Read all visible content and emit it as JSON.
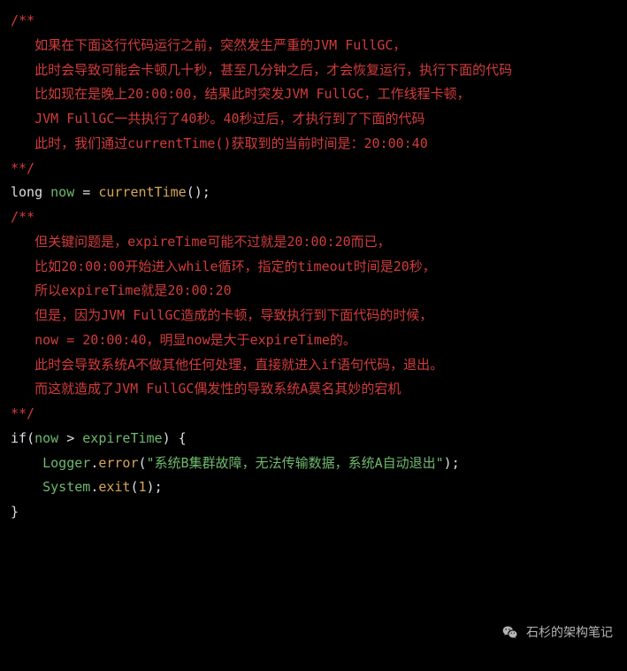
{
  "code": {
    "c1_open": "/**",
    "c1_l1": "   如果在下面这行代码运行之前，突然发生严重的JVM FullGC，",
    "c1_l2": "   此时会导致可能会卡顿几十秒，甚至几分钟之后，才会恢复运行，执行下面的代码",
    "c1_blank1": "",
    "c1_l3": "   比如现在是晚上20:00:00，结果此时突发JVM FullGC，工作线程卡顿，",
    "c1_l4": "   JVM FullGC一共执行了40秒。40秒过后，才执行到了下面的代码",
    "c1_blank2": "",
    "c1_l5": "   此时，我们通过currentTime()获取到的当前时间是：20:00:40",
    "c1_close": "**/",
    "stmt1_kw": "long",
    "stmt1_var": "now",
    "stmt1_eq": " = ",
    "stmt1_fn": "currentTime",
    "stmt1_paren": "()",
    "stmt1_semi": ";",
    "blank_mid": "",
    "c2_open": "/**",
    "c2_l1": "   但关键问题是，expireTime可能不过就是20:00:20而已，",
    "c2_l2": "   比如20:00:00开始进入while循环，指定的timeout时间是20秒，",
    "c2_l3": "   所以expireTime就是20:00:20",
    "c2_blank1": "",
    "c2_l4": "   但是，因为JVM FullGC造成的卡顿，导致执行到下面代码的时候，",
    "c2_l5": "   now = 20:00:40，明显now是大于expireTime的。",
    "c2_blank2": "",
    "c2_l6": "   此时会导致系统A不做其他任何处理，直接就进入if语句代码，退出。",
    "c2_l7": "   而这就造成了JVM FullGC偶发性的导致系统A莫名其妙的宕机",
    "c2_close": "**/",
    "if_kw": "if",
    "if_open": "(",
    "if_lhs": "now",
    "if_op": " > ",
    "if_rhs": "expireTime",
    "if_close": ") {",
    "log_indent": "    ",
    "log_obj": "Logger",
    "log_dot": ".",
    "log_method": "error",
    "log_open": "(",
    "log_str": "\"系统B集群故障，无法传输数据，系统A自动退出\"",
    "log_close": ")",
    "log_semi": ";",
    "exit_indent": "    ",
    "exit_obj": "System",
    "exit_dot": ".",
    "exit_method": "exit",
    "exit_open": "(",
    "exit_arg": "1",
    "exit_close": ")",
    "exit_semi": ";",
    "brace_close": "}"
  },
  "watermark": {
    "text": "石杉的架构笔记"
  }
}
